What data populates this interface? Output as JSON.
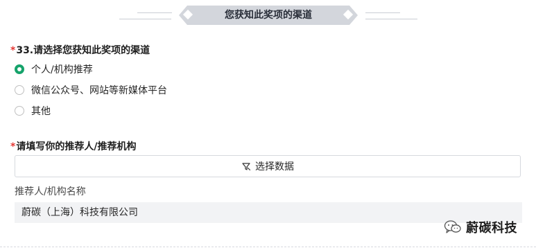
{
  "section": {
    "title": "您获知此奖项的渠道"
  },
  "question_channel": {
    "required_mark": "*",
    "title": "33.请选择您获知此奖项的渠道",
    "options": [
      {
        "label": "个人/机构推荐",
        "selected": true
      },
      {
        "label": "微信公众号、网站等新媒体平台",
        "selected": false
      },
      {
        "label": "其他",
        "selected": false
      }
    ]
  },
  "question_referrer": {
    "required_mark": "*",
    "title": "请填写你的推荐人/推荐机构",
    "select_button_label": "选择数据",
    "select_button_icon": "data-select-icon",
    "field_label": "推荐人/机构名称",
    "field_value": "蔚碳（上海）科技有限公司"
  },
  "watermark": {
    "text": "蔚碳科技",
    "icon": "wechat-icon"
  },
  "colors": {
    "accent_green": "#16a36b",
    "required_red": "#e53935",
    "banner_gray": "#d3d6dc"
  }
}
